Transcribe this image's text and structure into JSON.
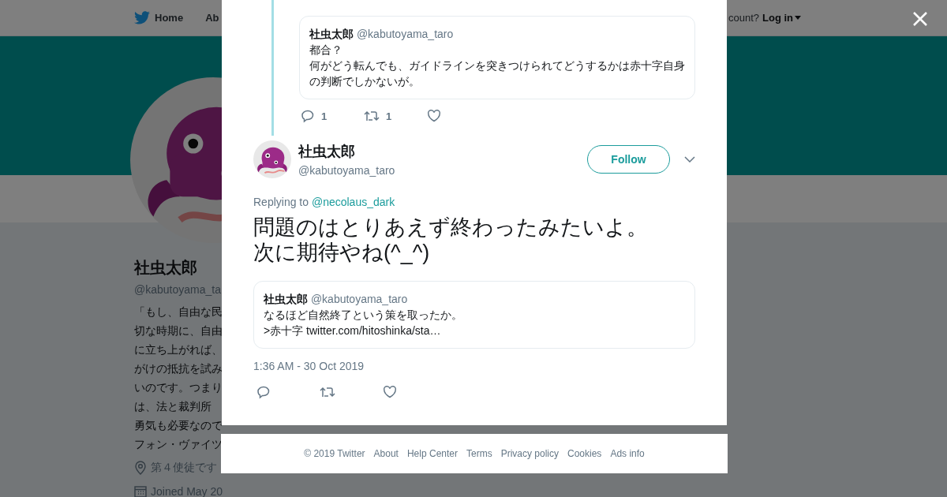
{
  "header": {
    "nav": [
      {
        "label": "Home",
        "kind": "home"
      },
      {
        "label": "Ab",
        "kind": "text"
      }
    ],
    "account_prompt": "count?",
    "login": "Log in"
  },
  "profile": {
    "name": "社虫太郎",
    "handle": "@kabutoyama_ta",
    "bio_lines": [
      "「もし、自由な民",
      "切な時期に、自由",
      "に立ち上がれば、",
      "がけの抵抗を試み",
      "いのです。つまり",
      "は、法と裁判所",
      "勇気も必要なので",
      "フォン・ヴァイツ"
    ],
    "location": "第４使徒です",
    "joined": "Joined May 20"
  },
  "modal": {
    "parent_tweet": {
      "quote": {
        "name": "社虫太郎",
        "handle": "@kabutoyama_taro",
        "lines": [
          "都合？",
          "何がどう転んでも、ガイドラインを突きつけられてどうするかは赤十字自身の判断でしかないが。"
        ]
      },
      "actions": [
        {
          "kind": "reply",
          "count": "1"
        },
        {
          "kind": "retweet",
          "count": "1"
        },
        {
          "kind": "like"
        }
      ]
    },
    "tweet": {
      "name": "社虫太郎",
      "handle": "@kabutoyama_taro",
      "follow_label": "Follow",
      "replying_prefix": "Replying to",
      "reply_to": "@necolaus_dark",
      "lines": [
        "問題のはとりあえず終わったみたいよ。",
        "次に期待やね(^_^)"
      ],
      "quote": {
        "name": "社虫太郎",
        "handle": "@kabutoyama_taro",
        "lines": [
          "なるほど自然終了という策を取ったか。",
          ">赤十字"
        ],
        "link": "twitter.com/hitoshinka/sta…"
      },
      "timestamp": "1:36 AM - 30 Oct 2019",
      "actions": [
        {
          "kind": "reply"
        },
        {
          "kind": "retweet"
        },
        {
          "kind": "like"
        }
      ]
    }
  },
  "footer": {
    "items": [
      "© 2019 Twitter",
      "About",
      "Help Center",
      "Terms",
      "Privacy policy",
      "Cookies",
      "Ads info"
    ]
  }
}
